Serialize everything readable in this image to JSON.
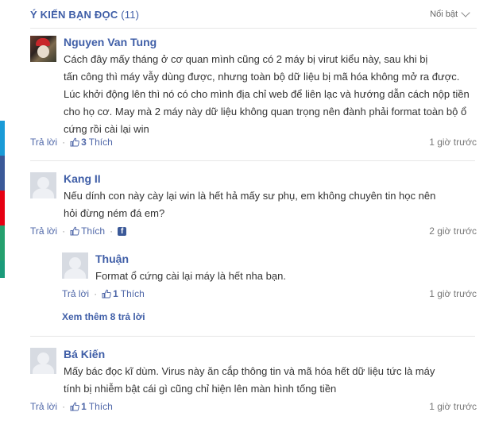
{
  "header": {
    "title": "Ý KIẾN BẠN ĐỌC",
    "count": "(11)",
    "sort_label": "Nổi bật"
  },
  "side_bars": [
    "#1a9bd7",
    "#3b5998",
    "#e60012",
    "#25a06e",
    "#1a9b7a"
  ],
  "comments": [
    {
      "name": "Nguyen Van Tung",
      "lines": [
        "Cách đây mấy tháng ở cơ quan mình cũng có 2 máy bị virut kiểu này, sau khi bị",
        "tấn công thì máy vẫy dùng được, nhưng toàn bộ dữ liệu bị mã hóa không mở ra được.",
        "Lúc khởi động lên thì nó có cho mình địa chỉ web để liên lạc và hướng dẫn cách nộp tiền",
        "cho họ cơ. May mà 2 máy này dữ liệu không quan trọng nên đành phải format toàn bộ ổ",
        "cứng rồi cài lại win"
      ],
      "reply_label": "Trả lời",
      "like_count": "3",
      "like_label": "Thích",
      "time": "1 giờ trước"
    },
    {
      "name": "Kang II",
      "lines": [
        "Nếu dính con này cày lại win là hết hả mấy sư phụ, em không chuyên tin học nên",
        "hỏi đừng ném đá em?"
      ],
      "reply_label": "Trả lời",
      "like_count": "",
      "like_label": "Thích",
      "share_icon": "facebook-icon",
      "time": "2 giờ trước"
    },
    {
      "name": "Thuận",
      "lines": [
        "Format ổ cứng cài lại máy là hết nha bạn."
      ],
      "reply_label": "Trả lời",
      "like_count": "1",
      "like_label": "Thích",
      "time": "1 giờ trước"
    },
    {
      "name": "Bá Kiến",
      "lines": [
        "Mấy bác đọc kĩ dùm. Virus này ăn cắp thông tin và mã hóa hết dữ liệu tức là máy",
        "tính bị nhiễm bật cái gì cũng chỉ hiện lên màn hình tống tiền"
      ],
      "reply_label": "Trả lời",
      "like_count": "1",
      "like_label": "Thích",
      "time": "1 giờ trước"
    }
  ],
  "more_replies": "Xem thêm 8 trả lời"
}
